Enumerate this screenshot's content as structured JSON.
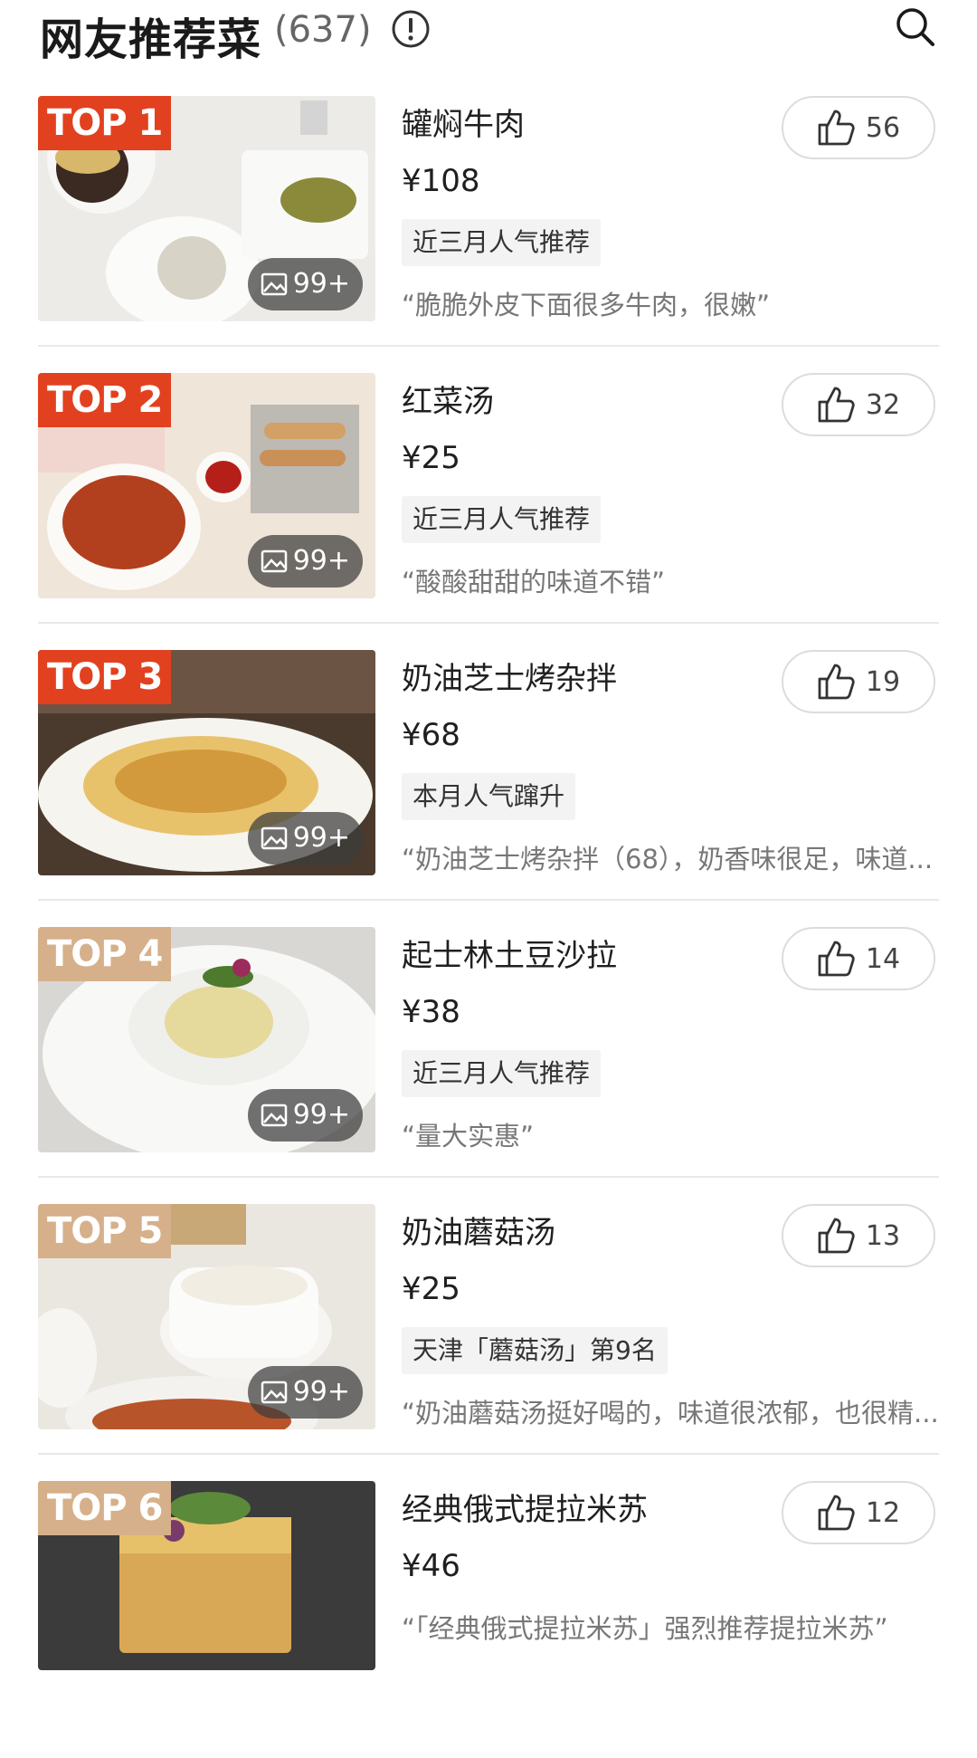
{
  "header": {
    "title": "网友推荐菜",
    "count": "(637)"
  },
  "dishes": [
    {
      "rank": "TOP 1",
      "name": "罐焖牛肉",
      "price": "¥108",
      "tag": "近三月人气推荐",
      "quote": "“脆脆外皮下面很多牛肉，很嫩”",
      "likes": "56",
      "photos": "99+"
    },
    {
      "rank": "TOP 2",
      "name": "红菜汤",
      "price": "¥25",
      "tag": "近三月人气推荐",
      "quote": "“酸酸甜甜的味道不错”",
      "likes": "32",
      "photos": "99+"
    },
    {
      "rank": "TOP 3",
      "name": "奶油芝士烤杂拌",
      "price": "¥68",
      "tag": "本月人气蹿升",
      "quote": "“奶油芝士烤杂拌（68），奶香味很足，味道...",
      "likes": "19",
      "photos": "99+"
    },
    {
      "rank": "TOP 4",
      "name": "起士林土豆沙拉",
      "price": "¥38",
      "tag": "近三月人气推荐",
      "quote": "“量大实惠”",
      "likes": "14",
      "photos": "99+"
    },
    {
      "rank": "TOP 5",
      "name": "奶油蘑菇汤",
      "price": "¥25",
      "tag": "天津「蘑菇汤」第9名",
      "quote": "“奶油蘑菇汤挺好喝的，味道很浓郁，也很精...",
      "likes": "13",
      "photos": "99+"
    },
    {
      "rank": "TOP 6",
      "name": "经典俄式提拉米苏",
      "price": "¥46",
      "tag": "",
      "quote": "“「经典俄式提拉米苏」强烈推荐提拉米苏”",
      "likes": "12",
      "photos": ""
    }
  ],
  "colors": {
    "badge_top": "#e2411f",
    "badge_low": "#d6b08a"
  }
}
